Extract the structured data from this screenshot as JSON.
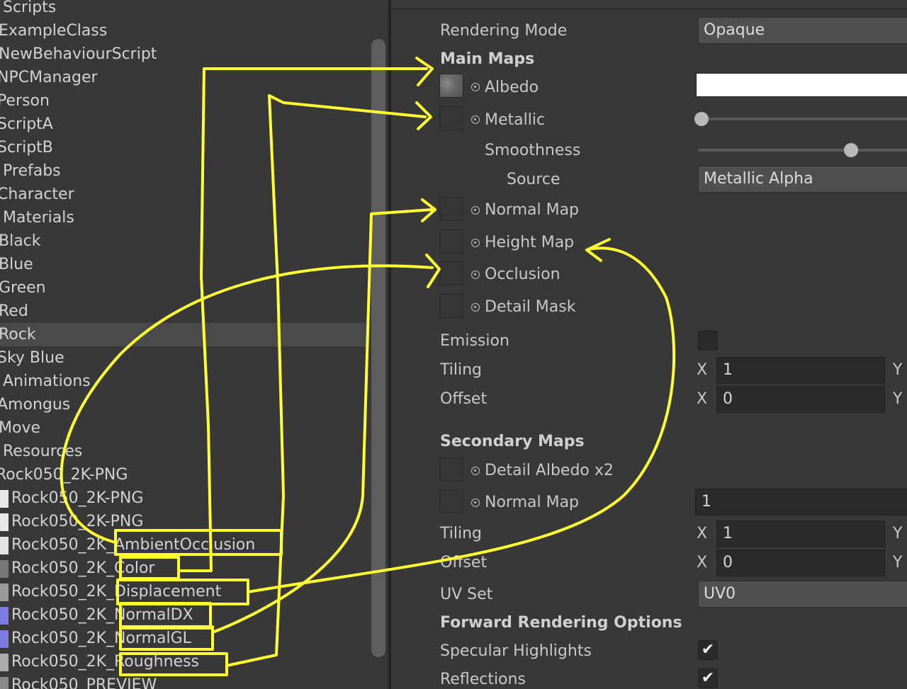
{
  "project": {
    "items": [
      {
        "label": "Scripts",
        "selected": false
      },
      {
        "label": "ExampleClass",
        "selected": false
      },
      {
        "label": "NewBehaviourScript",
        "selected": false
      },
      {
        "label": "NPCManager",
        "selected": false
      },
      {
        "label": "Person",
        "selected": false
      },
      {
        "label": "ScriptA",
        "selected": false
      },
      {
        "label": "ScriptB",
        "selected": false
      },
      {
        "label": "Prefabs",
        "selected": false
      },
      {
        "label": "Character",
        "selected": false
      },
      {
        "label": "Materials",
        "selected": false
      },
      {
        "label": "Black",
        "selected": false
      },
      {
        "label": "Blue",
        "selected": false
      },
      {
        "label": "Green",
        "selected": false
      },
      {
        "label": "Red",
        "selected": false
      },
      {
        "label": "Rock",
        "selected": true
      },
      {
        "label": "Sky Blue",
        "selected": false
      },
      {
        "label": "Animations",
        "selected": false
      },
      {
        "label": "Amongus",
        "selected": false
      },
      {
        "label": "Move",
        "selected": false
      },
      {
        "label": "Resources",
        "selected": false
      },
      {
        "label": "Rock050_2K-PNG",
        "selected": false
      },
      {
        "label": "Rock050_2K-PNG",
        "selected": false,
        "icon": "file-icon"
      },
      {
        "label": "Rock050_2K-PNG",
        "selected": false,
        "icon": "file-icon"
      },
      {
        "label": "Rock050_2K_AmbientOcclusion",
        "selected": false,
        "icon": "texture-ao-icon"
      },
      {
        "label": "Rock050_2K_Color",
        "selected": false,
        "icon": "texture-color-icon"
      },
      {
        "label": "Rock050_2K_Displacement",
        "selected": false,
        "icon": "texture-displacement-icon"
      },
      {
        "label": "Rock050_2K_NormalDX",
        "selected": false,
        "icon": "texture-normal-icon"
      },
      {
        "label": "Rock050_2K_NormalGL",
        "selected": false,
        "icon": "texture-normal-icon"
      },
      {
        "label": "Rock050_2K_Roughness",
        "selected": false,
        "icon": "texture-roughness-icon"
      },
      {
        "label": "Rock050_PREVIEW",
        "selected": false,
        "icon": "texture-preview-icon"
      }
    ]
  },
  "inspector": {
    "rendering_mode_label": "Rendering Mode",
    "rendering_mode_value": "Opaque",
    "main_maps_header": "Main Maps",
    "albedo_label": "Albedo",
    "metallic_label": "Metallic",
    "smoothness_label": "Smoothness",
    "source_label": "Source",
    "source_value": "Metallic Alpha",
    "normal_map_label": "Normal Map",
    "height_map_label": "Height Map",
    "occlusion_label": "Occlusion",
    "detail_mask_label": "Detail Mask",
    "emission_label": "Emission",
    "tiling_label": "Tiling",
    "tiling_x": "1",
    "offset_label": "Offset",
    "offset_x": "0",
    "secondary_maps_header": "Secondary Maps",
    "detail_albedo_label": "Detail Albedo x2",
    "secondary_normal_map_label": "Normal Map",
    "secondary_normal_value": "1",
    "secondary_tiling_label": "Tiling",
    "secondary_tiling_x": "1",
    "secondary_offset_label": "Offset",
    "secondary_offset_x": "0",
    "uv_set_label": "UV Set",
    "uv_set_value": "UV0",
    "forward_header": "Forward Rendering Options",
    "specular_label": "Specular Highlights",
    "reflections_label": "Reflections",
    "axis_x": "X",
    "axis_y": "Y",
    "check_glyph": "✔",
    "metallic_value": 0,
    "smoothness_value": 0.72
  },
  "colors": {
    "annotation": "#ffff33",
    "albedo_color": "#ffffff"
  }
}
